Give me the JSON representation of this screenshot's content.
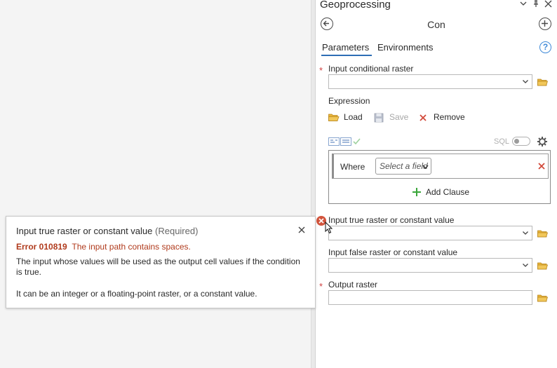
{
  "pane": {
    "title": "Geoprocessing",
    "tool_name": "Con"
  },
  "tabs": [
    {
      "label": "Parameters",
      "active": true
    },
    {
      "label": "Environments",
      "active": false
    }
  ],
  "params": {
    "input_conditional_raster": {
      "label": "Input conditional raster",
      "value": "",
      "required": true
    },
    "input_true_raster": {
      "label": "Input true raster or constant value",
      "value": "",
      "error": true
    },
    "input_false_raster": {
      "label": "Input false raster or constant value",
      "value": ""
    },
    "output_raster": {
      "label": "Output raster",
      "value": "",
      "required": true
    }
  },
  "expression": {
    "label": "Expression",
    "load_label": "Load",
    "save_label": "Save",
    "remove_label": "Remove",
    "sql_label": "SQL",
    "where_label": "Where",
    "field_placeholder": "Select a field",
    "add_clause_label": "Add Clause"
  },
  "tooltip": {
    "title": "Input true raster or constant value",
    "required_text": "(Required)",
    "error_code": "Error 010819",
    "error_message": "The input path contains spaces.",
    "description": "The input whose values will be used as the output cell values if the condition is true.",
    "description2": "It can be an integer or a floating-point raster, or a constant value."
  },
  "colors": {
    "accent": "#2d6db5",
    "error": "#b03a1c",
    "required_star": "#d04040",
    "folder": "#e2a92c",
    "add_green": "#3aa63a"
  }
}
